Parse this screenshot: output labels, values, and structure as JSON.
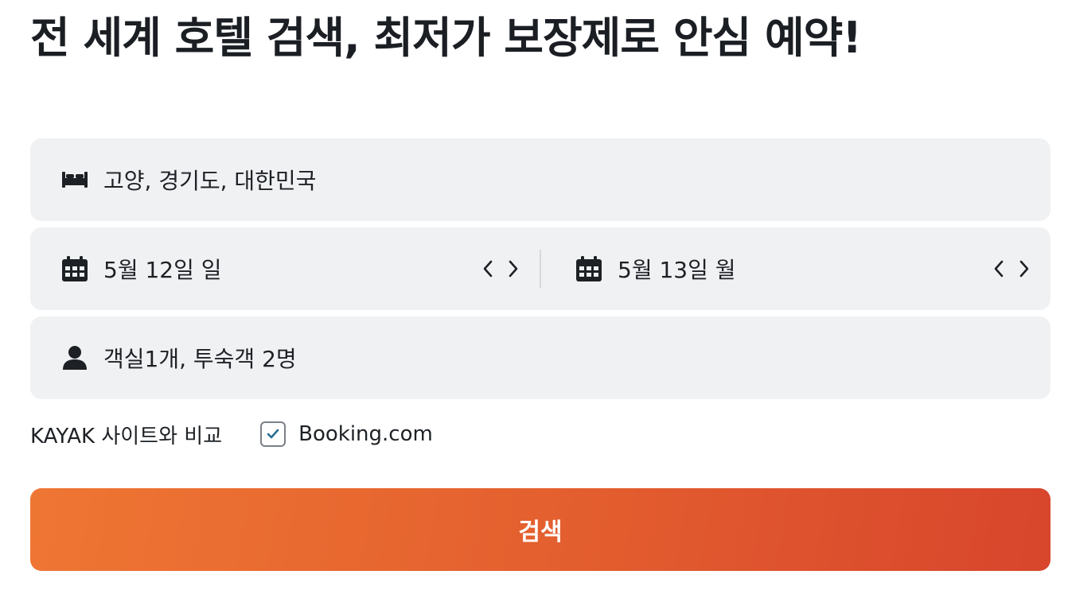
{
  "headline": "전 세계 호텔 검색, 최저가 보장제로 안심 예약!",
  "destination": {
    "icon": "bed-icon",
    "value": "고양, 경기도, 대한민국"
  },
  "dates": {
    "checkin": {
      "icon": "calendar-icon",
      "value": "5월 12일 일"
    },
    "checkout": {
      "icon": "calendar-icon",
      "value": "5월 13일 월"
    }
  },
  "guests": {
    "icon": "person-icon",
    "value": "객실1개, 투숙객 2명"
  },
  "compare": {
    "label": "KAYAK 사이트와 비교",
    "option_label": "Booking.com",
    "checked": true
  },
  "search_button": {
    "label": "검색"
  },
  "colors": {
    "accent_start": "#ee7633",
    "accent_end": "#d8452c",
    "field_bg": "#f0f1f3",
    "check_mark": "#2a6e93"
  }
}
